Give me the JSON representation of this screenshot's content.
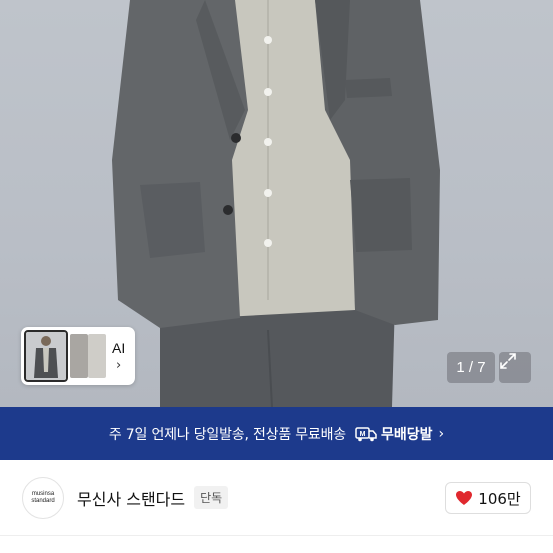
{
  "gallery": {
    "ai_label": "AI",
    "ai_chevron": "›",
    "counter": "1 / 7",
    "expand_icon": "expand-icon",
    "image_alt": "product photo - grey jacket and shirt"
  },
  "banner": {
    "text": "주 7일 언제나 당일발송, 전상품 무료배송",
    "badge": "무배당발",
    "badge_icon": "truck-icon",
    "chevron": "›",
    "background": "#1d3a8c"
  },
  "brand": {
    "logo_line1": "musinsa",
    "logo_line2": "standard",
    "name": "무신사 스탠다드",
    "tag": "단독",
    "likes": "106만",
    "like_icon": "heart-icon",
    "like_color": "#e0282e"
  }
}
